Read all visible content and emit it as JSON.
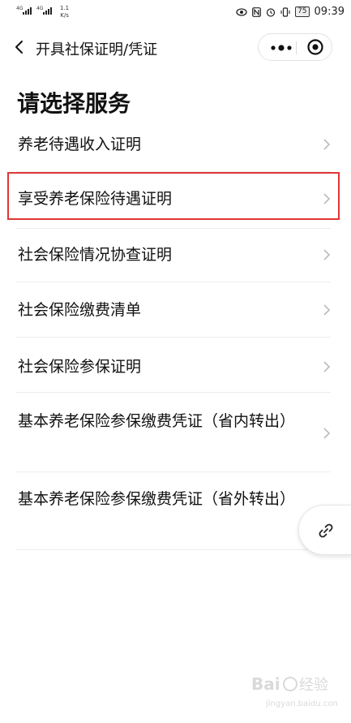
{
  "status_bar": {
    "net1": "4G",
    "net2": "4G",
    "speed": "1.1",
    "speed_unit": "K/s",
    "battery": "75",
    "time": "09:39"
  },
  "nav": {
    "title": "开具社保证明/凭证"
  },
  "page": {
    "heading": "请选择服务",
    "services": [
      "养老待遇收入证明",
      "享受养老保险待遇证明",
      "社会保险情况协查证明",
      "社会保险缴费清单",
      "社会保险参保证明",
      "基本养老保险参保缴费凭证（省内转出）",
      "基本养老保险参保缴费凭证（省外转出）"
    ],
    "highlighted_index": 1
  },
  "watermark": {
    "text": "Baidu 经验",
    "url": "jingyan.baidu.com"
  },
  "icons": {
    "back": "chevron-left-icon",
    "more": "more-dots-icon",
    "close": "target-close-icon",
    "row_arrow": "chevron-right-icon",
    "floating": "link-icon"
  },
  "colors": {
    "highlight_border": "#e03636",
    "divider": "#ececec",
    "chevron": "#bbbbbb"
  }
}
